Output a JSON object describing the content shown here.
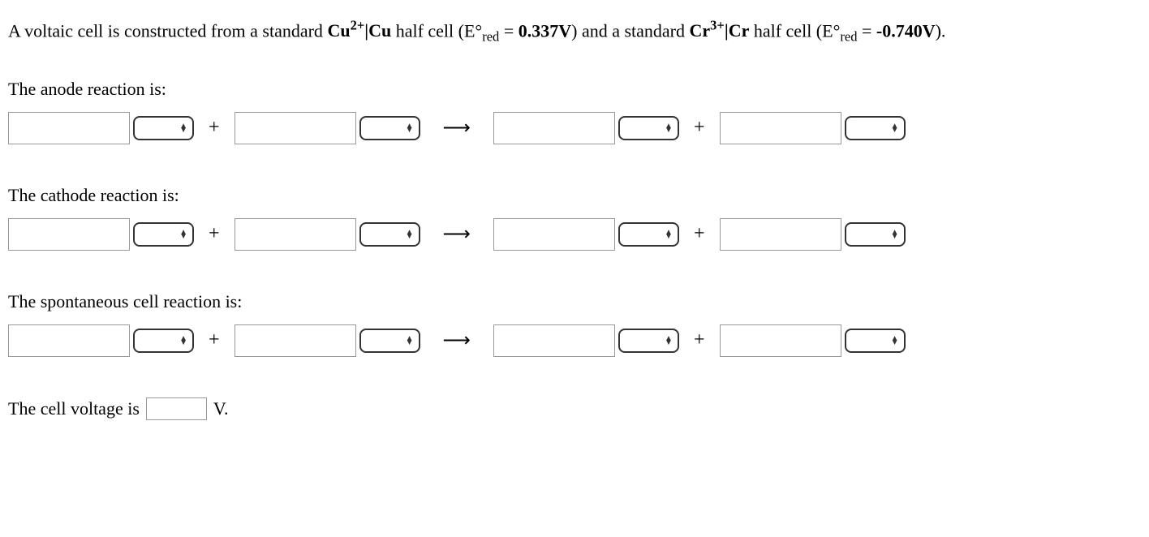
{
  "intro": {
    "text1": "A voltaic cell is constructed from a standard ",
    "ion1": "Cu",
    "ion1_charge": "2+",
    "pipe": "|",
    "metal1": "Cu",
    "text2": " half cell (E°",
    "sub_red": "red",
    "eq": " = ",
    "val1": "0.337V",
    "text3": ") and a standard ",
    "ion2": "Cr",
    "ion2_charge": "3+",
    "metal2": "Cr",
    "text4": " half cell (E°",
    "val2": "-0.740V",
    "text5": ")."
  },
  "labels": {
    "anode": "The anode reaction is:",
    "cathode": "The cathode reaction is:",
    "spontaneous": "The spontaneous cell reaction is:",
    "voltage_prefix": "The cell voltage is",
    "voltage_unit": "V."
  },
  "symbols": {
    "plus": "+",
    "arrow": "⟶"
  }
}
